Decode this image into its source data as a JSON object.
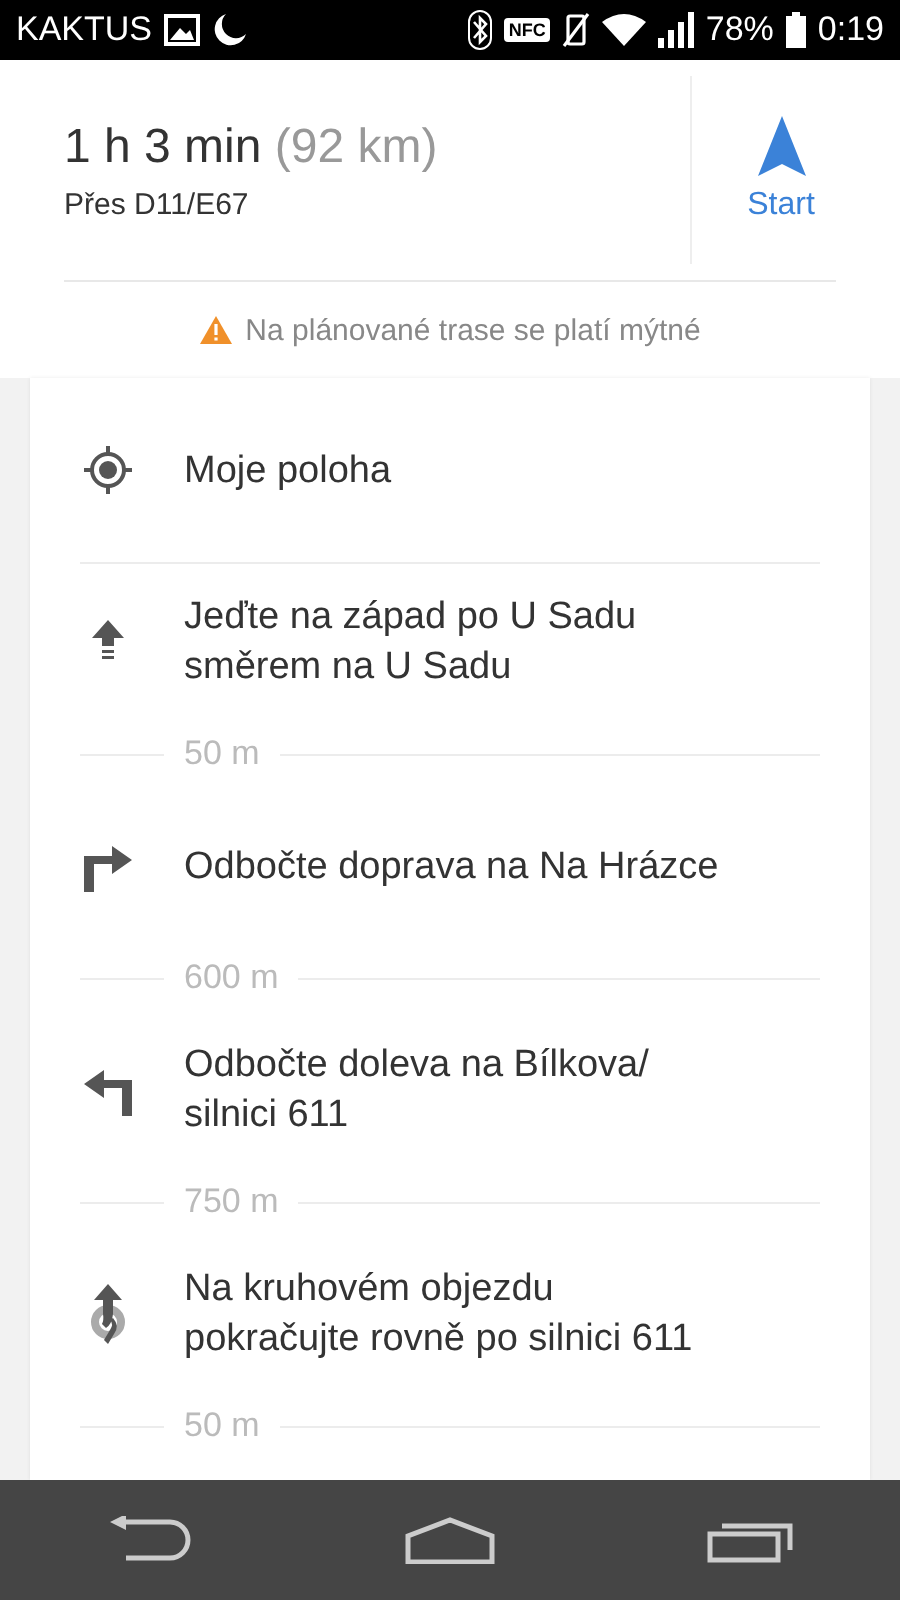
{
  "status_bar": {
    "carrier": "KAKTUS",
    "nfc_label": "NFC",
    "battery": "78%",
    "time": "0:19"
  },
  "summary": {
    "duration": "1 h 3 min",
    "distance": "(92 km)",
    "via": "Přes D11/E67",
    "start_label": "Start"
  },
  "toll_warning": "Na plánované trase se platí mýtné",
  "steps": [
    {
      "kind": "location",
      "text": "Moje poloha"
    },
    {
      "kind": "straight",
      "text": "Jeďte na západ po U Sadu směrem na U Sadu",
      "distance": "50 m"
    },
    {
      "kind": "right",
      "text": "Odbočte doprava na Na Hrázce",
      "distance": "600 m"
    },
    {
      "kind": "left",
      "text": "Odbočte doleva na Bílkova/ silnici 611",
      "distance": "750 m"
    },
    {
      "kind": "roundabout",
      "text": "Na kruhovém objezdu pokračujte rovně po silnici 611",
      "distance": "50 m"
    }
  ]
}
